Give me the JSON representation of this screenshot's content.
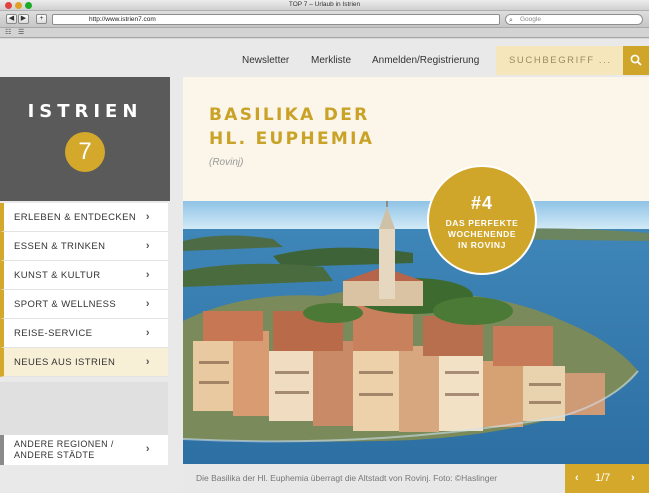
{
  "window": {
    "title": "TOP 7 – Urlaub in Istrien"
  },
  "toolbar": {
    "url": "http://www.istrien7.com",
    "search_placeholder": "Google",
    "back": "◀",
    "forward": "▶",
    "add": "+"
  },
  "bookmarks": {
    "book_icon": "☷",
    "grid_icon": "☰"
  },
  "topnav": {
    "links": [
      "Newsletter",
      "Merkliste",
      "Anmelden/Registrierung"
    ],
    "search_placeholder": "SUCHBEGRIFF ..."
  },
  "brand": {
    "title": "ISTRIEN",
    "number": "7"
  },
  "menu": {
    "items": [
      {
        "label": "ERLEBEN & ENTDECKEN"
      },
      {
        "label": "ESSEN & TRINKEN"
      },
      {
        "label": "KUNST & KULTUR"
      },
      {
        "label": "SPORT & WELLNESS"
      },
      {
        "label": "REISE-SERVICE"
      },
      {
        "label": "NEUES AUS ISTRIEN"
      }
    ],
    "chevron": "›",
    "other_line1": "ANDERE REGIONEN /",
    "other_line2": "ANDERE STÄDTE"
  },
  "article": {
    "title_line1": "BASILIKA DER",
    "title_line2": "HL. EUPHEMIA",
    "location": "(Rovinj)",
    "badge_number": "#4",
    "badge_line1": "DAS PERFEKTE",
    "badge_line2": "WOCHENENDE",
    "badge_line3": "IN ROVINJ",
    "caption": "Die Basilika der Hl. Euphemia überragt die Altstadt von Rovinj. Foto: ©Haslinger",
    "pager": "1/7",
    "prev": "‹",
    "next": "›"
  },
  "colors": {
    "accent": "#d4a82a",
    "sidebar_dark": "#5a5a5a",
    "cream": "#fbf6e9"
  }
}
